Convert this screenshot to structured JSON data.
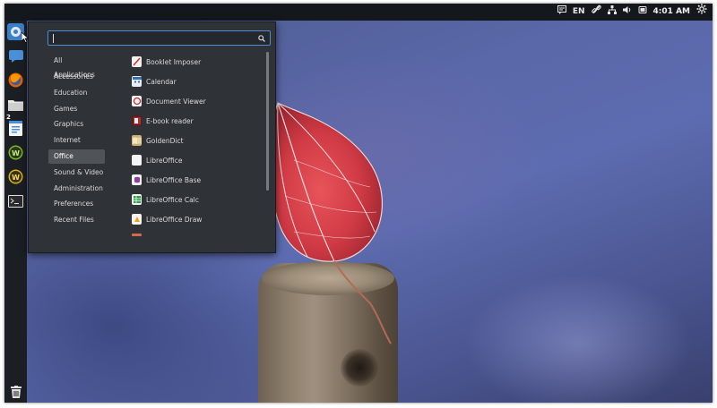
{
  "topbar": {
    "language": "EN",
    "clock": "4:01 AM",
    "icons": [
      "chat-indicator-icon",
      "link-icon",
      "network-icon",
      "volume-icon",
      "battery-icon",
      "settings-gear-icon"
    ]
  },
  "dock": {
    "items": [
      {
        "name": "applications-menu-icon"
      },
      {
        "name": "messaging-icon"
      },
      {
        "name": "firefox-icon"
      },
      {
        "name": "files-icon"
      },
      {
        "name": "text-editor-icon",
        "badge": "2"
      },
      {
        "name": "wps-writer-icon"
      },
      {
        "name": "wps-presentation-icon"
      },
      {
        "name": "terminal-icon"
      },
      {
        "name": "trash-icon"
      }
    ]
  },
  "menu": {
    "search": {
      "value": "",
      "placeholder": ""
    },
    "categories": [
      "All Applications",
      "Accessories",
      "Education",
      "Games",
      "Graphics",
      "Internet",
      "Office",
      "Sound & Video",
      "Administration",
      "Preferences",
      "Recent Files"
    ],
    "active_category": "Office",
    "apps": [
      {
        "label": "Booklet Imposer",
        "icon": "booklet-imposer-icon"
      },
      {
        "label": "Calendar",
        "icon": "calendar-icon"
      },
      {
        "label": "Document Viewer",
        "icon": "document-viewer-icon"
      },
      {
        "label": "E-book reader",
        "icon": "ebook-reader-icon"
      },
      {
        "label": "GoldenDict",
        "icon": "goldendict-icon"
      },
      {
        "label": "LibreOffice",
        "icon": "libreoffice-icon"
      },
      {
        "label": "LibreOffice Base",
        "icon": "libreoffice-base-icon"
      },
      {
        "label": "LibreOffice Calc",
        "icon": "libreoffice-calc-icon"
      },
      {
        "label": "LibreOffice Draw",
        "icon": "libreoffice-draw-icon"
      }
    ]
  },
  "colors": {
    "panel": "#14171c",
    "menu_bg": "#2f3236",
    "accent": "#4a8fd6",
    "selection": "#505459"
  }
}
